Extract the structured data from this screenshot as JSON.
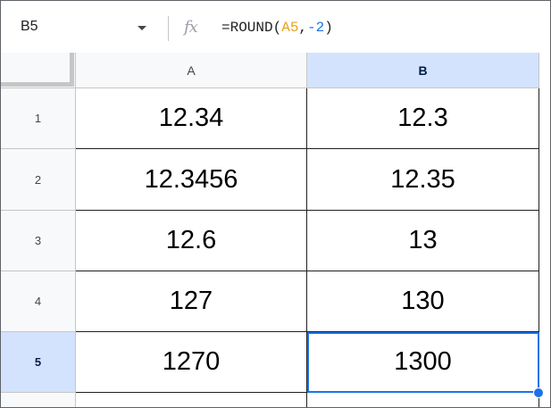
{
  "formula_bar": {
    "name_box": "B5",
    "fx_icon": "fx",
    "formula_prefix": "=ROUND(",
    "formula_ref": "A5",
    "formula_sep": ",",
    "formula_num": "-2",
    "formula_suffix": ")"
  },
  "columns": [
    {
      "label": "A"
    },
    {
      "label": "B"
    }
  ],
  "rows": [
    {
      "label": "1",
      "a": "12.34",
      "b": "12.3"
    },
    {
      "label": "2",
      "a": "12.3456",
      "b": "12.35"
    },
    {
      "label": "3",
      "a": "12.6",
      "b": "13"
    },
    {
      "label": "4",
      "a": "127",
      "b": "130"
    },
    {
      "label": "5",
      "a": "1270",
      "b": "1300"
    }
  ],
  "colors": {
    "selection": "#1a73e8",
    "header_active": "#d3e3fd",
    "formula_ref": "#e8a317",
    "formula_number": "#1a73e8"
  }
}
